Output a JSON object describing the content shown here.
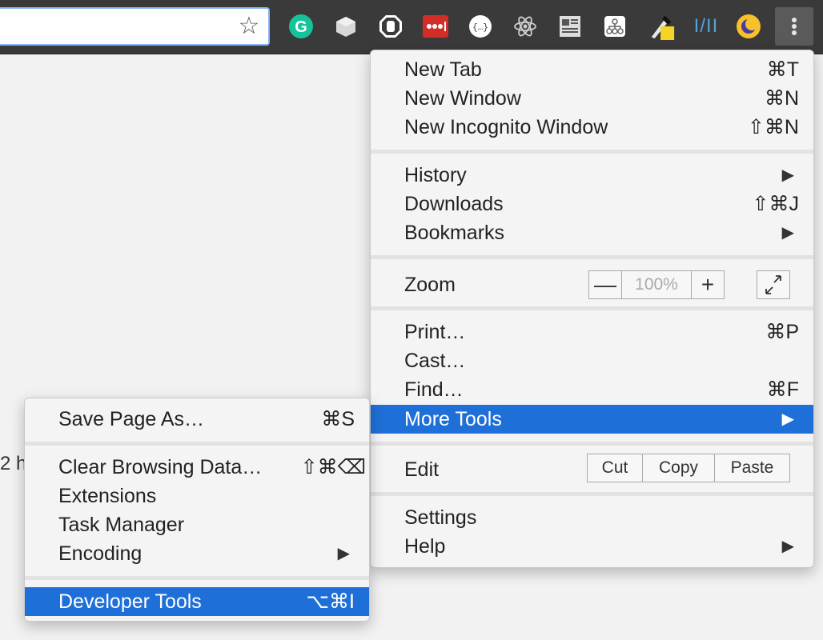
{
  "omnibox": {
    "value": ""
  },
  "page": {
    "fragment": "2 h"
  },
  "extensions": [
    {
      "name": "grammarly-icon",
      "color": "#15c39a"
    },
    {
      "name": "cube-extension-icon",
      "color": "#cfcfcf"
    },
    {
      "name": "ad-block-hand-icon",
      "color": "#ffffff"
    },
    {
      "name": "lastpass-icon",
      "color": "#d32d27"
    },
    {
      "name": "json-viewer-icon",
      "color": "#ffffff"
    },
    {
      "name": "react-devtools-icon",
      "color": "#cfcfcf"
    },
    {
      "name": "reader-view-icon",
      "color": "#cfcfcf"
    },
    {
      "name": "sitemap-icon",
      "color": "#cfcfcf"
    },
    {
      "name": "color-picker-icon",
      "color": "#f5d327"
    },
    {
      "name": "stylebot-icon",
      "color": "#4fa3d8",
      "text": "I/II"
    },
    {
      "name": "night-mode-moon-icon",
      "color": "#f6c12b"
    }
  ],
  "main_menu": {
    "new_tab": {
      "label": "New Tab",
      "shortcut": "⌘T"
    },
    "new_window": {
      "label": "New Window",
      "shortcut": "⌘N"
    },
    "new_incognito": {
      "label": "New Incognito Window",
      "shortcut": "⇧⌘N"
    },
    "history": {
      "label": "History",
      "arrow": "▶"
    },
    "downloads": {
      "label": "Downloads",
      "shortcut": "⇧⌘J"
    },
    "bookmarks": {
      "label": "Bookmarks",
      "arrow": "▶"
    },
    "zoom": {
      "label": "Zoom",
      "minus": "—",
      "value": "100%",
      "plus": "+"
    },
    "print": {
      "label": "Print…",
      "shortcut": "⌘P"
    },
    "cast": {
      "label": "Cast…"
    },
    "find": {
      "label": "Find…",
      "shortcut": "⌘F"
    },
    "more_tools": {
      "label": "More Tools",
      "arrow": "▶"
    },
    "edit": {
      "label": "Edit",
      "cut": "Cut",
      "copy": "Copy",
      "paste": "Paste"
    },
    "settings": {
      "label": "Settings"
    },
    "help": {
      "label": "Help",
      "arrow": "▶"
    }
  },
  "sub_menu": {
    "save_page": {
      "label": "Save Page As…",
      "shortcut": "⌘S"
    },
    "clear_data": {
      "label": "Clear Browsing Data…",
      "shortcut": "⇧⌘⌫"
    },
    "extensions": {
      "label": "Extensions"
    },
    "task_manager": {
      "label": "Task Manager"
    },
    "encoding": {
      "label": "Encoding",
      "arrow": "▶"
    },
    "developer_tools": {
      "label": "Developer Tools",
      "shortcut": "⌥⌘I"
    }
  },
  "colors": {
    "highlight": "#1f6fd8",
    "toolbar": "#3a3a3a"
  }
}
